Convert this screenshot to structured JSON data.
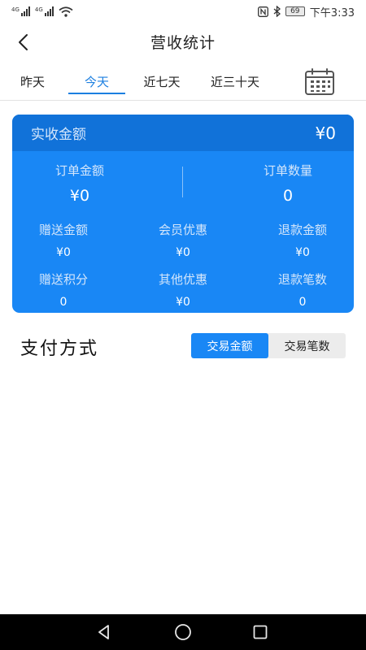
{
  "status_bar": {
    "network_1": "4G",
    "network_2": "4G",
    "battery": "69",
    "time": "下午3:33"
  },
  "nav": {
    "title": "营收统计",
    "back_icon": "back-arrow-icon"
  },
  "tabs": [
    {
      "label": "昨天",
      "active": false
    },
    {
      "label": "今天",
      "active": true
    },
    {
      "label": "近七天",
      "active": false
    },
    {
      "label": "近三十天",
      "active": false
    }
  ],
  "calendar_icon": "calendar-icon",
  "summary": {
    "actual_label": "实收金额",
    "actual_value": "¥0",
    "order_amount_label": "订单金额",
    "order_amount_value": "¥0",
    "order_count_label": "订单数量",
    "order_count_value": "0",
    "metrics": [
      {
        "label": "赠送金额",
        "value": "¥0"
      },
      {
        "label": "会员优惠",
        "value": "¥0"
      },
      {
        "label": "退款金额",
        "value": "¥0"
      },
      {
        "label": "赠送积分",
        "value": "0"
      },
      {
        "label": "其他优惠",
        "value": "¥0"
      },
      {
        "label": "退款笔数",
        "value": "0"
      }
    ]
  },
  "payment": {
    "title": "支付方式",
    "toggle": [
      {
        "label": "交易金额",
        "active": true
      },
      {
        "label": "交易笔数",
        "active": false
      }
    ]
  },
  "colors": {
    "accent": "#1c7fe0",
    "card": "#1987f5",
    "card_header": "#1172d9"
  }
}
